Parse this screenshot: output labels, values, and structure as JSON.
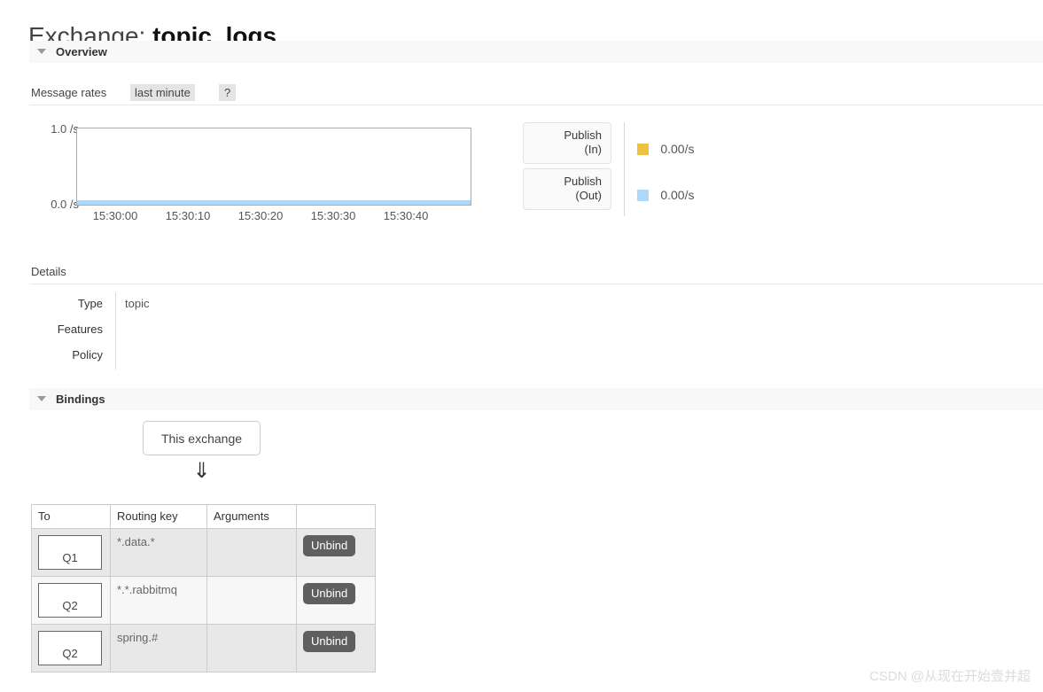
{
  "page": {
    "title_prefix": "Exchange:",
    "exchange_name": "topic_logs"
  },
  "overview": {
    "section_label": "Overview",
    "rates_label": "Message rates",
    "period_chip": "last minute",
    "help_chip": "?",
    "rate_buttons": [
      {
        "label": "Publish\n(In)",
        "line1": "Publish",
        "line2": "(In)"
      },
      {
        "label": "Publish\n(Out)",
        "line1": "Publish",
        "line2": "(Out)"
      }
    ],
    "legend": [
      {
        "name": "Publish (In)",
        "value": "0.00/s",
        "color": "#edc240"
      },
      {
        "name": "Publish (Out)",
        "value": "0.00/s",
        "color": "#afd8f8"
      }
    ]
  },
  "chart_data": {
    "type": "line",
    "title": "Message rates",
    "xlabel": "",
    "ylabel": "",
    "x": [
      "15:30:00",
      "15:30:10",
      "15:30:20",
      "15:30:30",
      "15:30:40"
    ],
    "ytick_labels": [
      "0.0 /s",
      "1.0 /s"
    ],
    "ylim": [
      0,
      1
    ],
    "grid": false,
    "legend_position": "right",
    "series": [
      {
        "name": "Publish (In)",
        "color": "#edc240",
        "values": [
          0,
          0,
          0,
          0,
          0
        ]
      },
      {
        "name": "Publish (Out)",
        "color": "#afd8f8",
        "values": [
          0,
          0,
          0,
          0,
          0
        ]
      }
    ]
  },
  "details": {
    "section_label": "Details",
    "rows": [
      {
        "key": "Type",
        "value": "topic"
      },
      {
        "key": "Features",
        "value": ""
      },
      {
        "key": "Policy",
        "value": ""
      }
    ]
  },
  "bindings": {
    "section_label": "Bindings",
    "this_exchange_label": "This exchange",
    "arrow_glyph": "⇓",
    "columns": [
      "To",
      "Routing key",
      "Arguments",
      ""
    ],
    "rows": [
      {
        "to": "Q1",
        "routing_key": "*.data.*",
        "arguments": "",
        "action": "Unbind"
      },
      {
        "to": "Q2",
        "routing_key": "*.*.rabbitmq",
        "arguments": "",
        "action": "Unbind"
      },
      {
        "to": "Q2",
        "routing_key": "spring.#",
        "arguments": "",
        "action": "Unbind"
      }
    ]
  },
  "watermark": {
    "text": "CSDN @从现在开始壹并超"
  }
}
